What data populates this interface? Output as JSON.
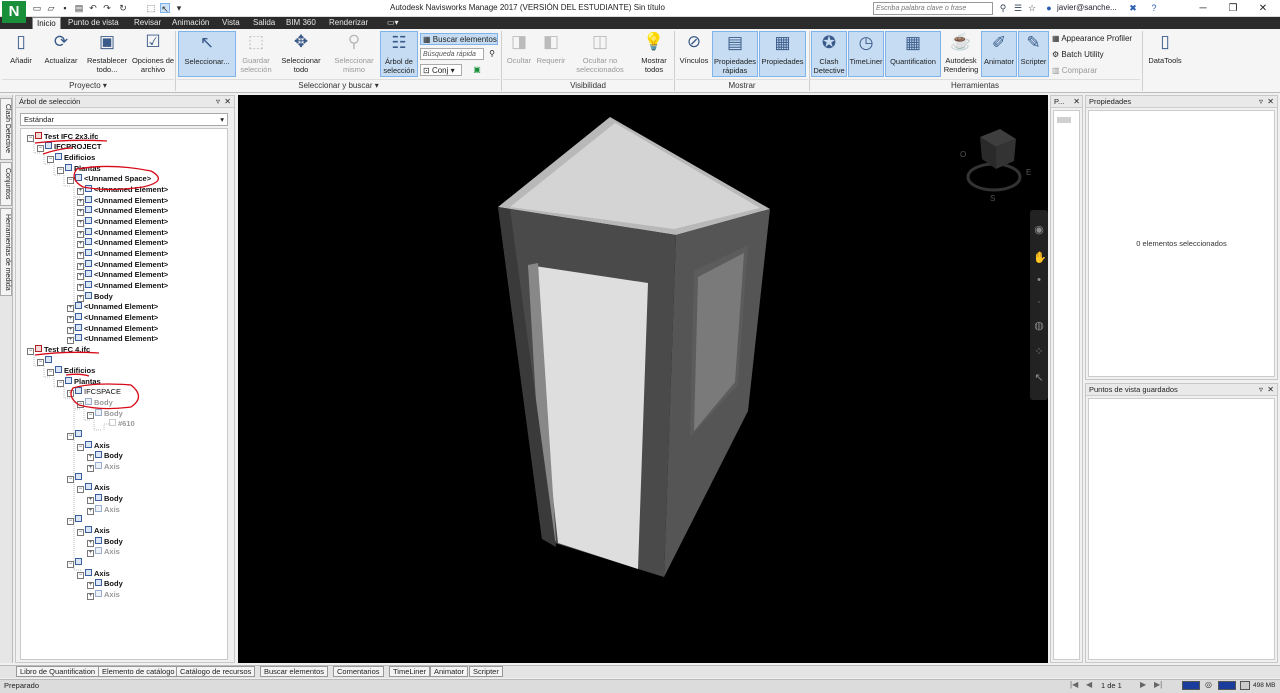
{
  "app": {
    "title": "Autodesk Navisworks Manage 2017 (VERSIÓN DEL ESTUDIANTE)    Sin título",
    "logo_letter": "N",
    "search_placeholder": "Escriba palabra clave o frase",
    "user": "javier@sanche...",
    "accent": "#1a8f3a"
  },
  "tabs": [
    "Inicio",
    "Punto de vista",
    "Revisar",
    "Animación",
    "Vista",
    "Salida",
    "BIM 360",
    "Renderizar"
  ],
  "ribbon": {
    "proyecto": {
      "group": "Proyecto",
      "buttons": [
        "Añadir",
        "Actualizar",
        "Restablecer todo...",
        "Opciones de archivo"
      ]
    },
    "seleccionar": {
      "group": "Seleccionar y buscar",
      "buttons": [
        "Seleccionar...",
        "Guardar selección",
        "Seleccionar todo",
        "Seleccionar mismo",
        "Árbol de selección"
      ],
      "find_items": "Buscar elementos",
      "quick_find": "Búsqueda rápida",
      "sets": "Conj"
    },
    "visibilidad": {
      "group": "Visibilidad",
      "buttons": [
        "Ocultar",
        "Requerir",
        "Ocultar no seleccionados",
        "Mostrar todos"
      ]
    },
    "mostrar": {
      "group": "Mostrar",
      "buttons": [
        "Vínculos",
        "Propiedades rápidas",
        "Propiedades"
      ]
    },
    "herramientas": {
      "group": "Herramientas",
      "buttons": [
        "Clash Detective",
        "TimeLiner",
        "Quantification",
        "Autodesk Rendering",
        "Animator",
        "Scripter"
      ],
      "small": [
        "Appearance Profiler",
        "Batch Utility",
        "Comparar"
      ]
    },
    "datatools": "DataTools"
  },
  "left_strip": [
    "Clash Detective",
    "Conjuntos",
    "Herramientas de medida"
  ],
  "selection_tree": {
    "title": "Árbol de selección",
    "mode": "Estándar",
    "rows": [
      {
        "label": "Test IFC 2x3.ifc"
      },
      {
        "label": "IFCPROJECT"
      },
      {
        "label": "Edificios"
      },
      {
        "label": "Plantas"
      },
      {
        "label": "<Unnamed Space>"
      },
      {
        "label": "<Unnamed Element>"
      },
      {
        "label": "<Unnamed Element>"
      },
      {
        "label": "<Unnamed Element>"
      },
      {
        "label": "<Unnamed Element>"
      },
      {
        "label": "<Unnamed Element>"
      },
      {
        "label": "<Unnamed Element>"
      },
      {
        "label": "<Unnamed Element>"
      },
      {
        "label": "<Unnamed Element>"
      },
      {
        "label": "<Unnamed Element>"
      },
      {
        "label": "<Unnamed Element>"
      },
      {
        "label": "Body"
      },
      {
        "label": "<Unnamed Element>"
      },
      {
        "label": "<Unnamed Element>"
      },
      {
        "label": "<Unnamed Element>"
      },
      {
        "label": "<Unnamed Element>"
      },
      {
        "label": "Test IFC 4.ifc"
      },
      {
        "label": ""
      },
      {
        "label": "Edificios"
      },
      {
        "label": "Plantas"
      },
      {
        "label": "IFCSPACE"
      },
      {
        "label": "Body"
      },
      {
        "label": "Body"
      },
      {
        "label": "#610"
      },
      {
        "label": ""
      },
      {
        "label": "Axis"
      },
      {
        "label": "Body"
      },
      {
        "label": "Axis"
      },
      {
        "label": ""
      },
      {
        "label": "Axis"
      },
      {
        "label": "Body"
      },
      {
        "label": "Axis"
      },
      {
        "label": ""
      },
      {
        "label": "Axis"
      },
      {
        "label": "Body"
      },
      {
        "label": "Axis"
      },
      {
        "label": ""
      },
      {
        "label": "Axis"
      },
      {
        "label": "Body"
      },
      {
        "label": "Axis"
      }
    ]
  },
  "viewcube": {
    "labels": [
      "O",
      "E",
      "S"
    ]
  },
  "panels": {
    "points_short": "P...",
    "properties_title": "Propiedades",
    "properties_empty": "0 elementos seleccionados",
    "saved_views_title": "Puntos de vista guardados"
  },
  "bottom_tabs": [
    "Libro de Quantification",
    "Elemento de catálogo",
    "Catálogo de recursos",
    "Buscar elementos",
    "Comentarios",
    "TimeLiner",
    "Animator",
    "Scripter"
  ],
  "status": {
    "text": "Preparado",
    "page": "1 de 1",
    "memory": "498 MB"
  }
}
